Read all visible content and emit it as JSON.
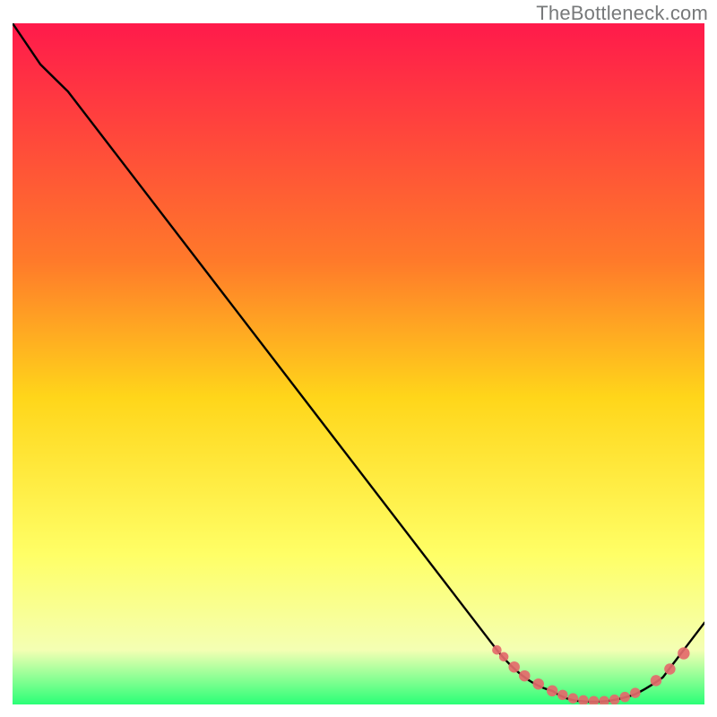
{
  "watermark": "TheBottleneck.com",
  "colors": {
    "grad_top": "#ff1a4b",
    "grad_mid1": "#ff7a2a",
    "grad_mid2": "#ffd61a",
    "grad_mid3": "#ffff66",
    "grad_mid4": "#f4ffb3",
    "grad_bot": "#2aff77",
    "curve": "#000000",
    "marker_fill": "#e46a6b",
    "marker_stroke": "#e46a6b"
  },
  "chart_data": {
    "type": "line",
    "title": "",
    "xlabel": "",
    "ylabel": "",
    "xlim": [
      0,
      100
    ],
    "ylim": [
      0,
      100
    ],
    "series": [
      {
        "name": "bottleneck-curve",
        "x": [
          0,
          4,
          8,
          70,
          78,
          82,
          86,
          90,
          94,
          100
        ],
        "values": [
          100,
          94,
          90,
          8,
          2,
          0.5,
          0.5,
          1.5,
          4,
          12
        ]
      }
    ],
    "markers": {
      "name": "highlighted-points",
      "points": [
        {
          "x": 70,
          "y": 8,
          "r": 2.2
        },
        {
          "x": 71,
          "y": 7,
          "r": 2.2
        },
        {
          "x": 72.5,
          "y": 5.5,
          "r": 2.6
        },
        {
          "x": 74,
          "y": 4.2,
          "r": 2.6
        },
        {
          "x": 76,
          "y": 3,
          "r": 2.6
        },
        {
          "x": 78,
          "y": 2,
          "r": 2.6
        },
        {
          "x": 79.5,
          "y": 1.4,
          "r": 2.4
        },
        {
          "x": 81,
          "y": 0.9,
          "r": 2.4
        },
        {
          "x": 82.5,
          "y": 0.6,
          "r": 2.4
        },
        {
          "x": 84,
          "y": 0.5,
          "r": 2.4
        },
        {
          "x": 85.5,
          "y": 0.5,
          "r": 2.4
        },
        {
          "x": 87,
          "y": 0.7,
          "r": 2.4
        },
        {
          "x": 88.5,
          "y": 1.1,
          "r": 2.4
        },
        {
          "x": 90,
          "y": 1.7,
          "r": 2.4
        },
        {
          "x": 93,
          "y": 3.5,
          "r": 2.6
        },
        {
          "x": 95,
          "y": 5.2,
          "r": 2.6
        },
        {
          "x": 97,
          "y": 7.5,
          "r": 2.8
        }
      ]
    }
  }
}
